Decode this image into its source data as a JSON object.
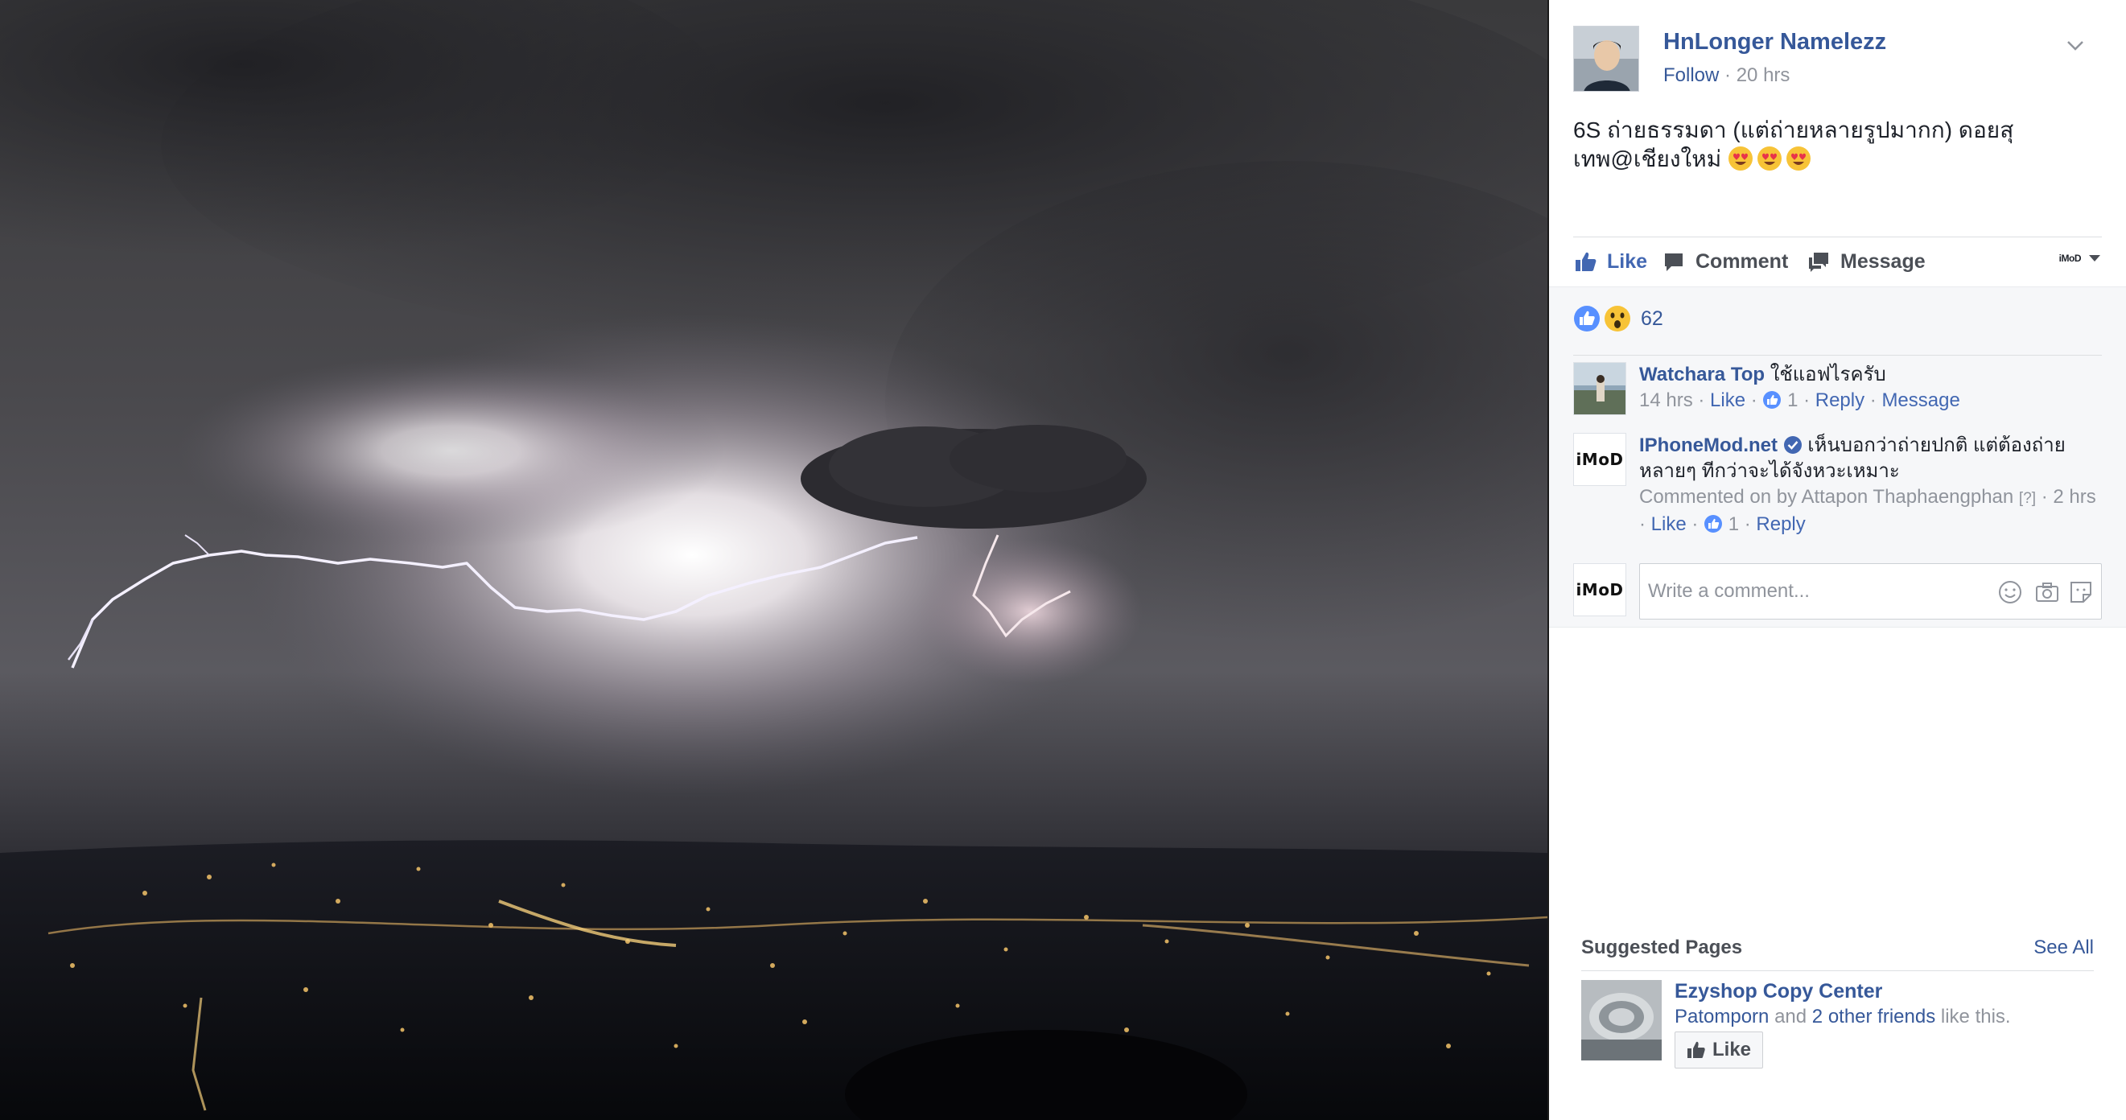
{
  "post": {
    "author": "HnLonger Namelezz",
    "follow_label": "Follow",
    "separator": "·",
    "time": "20 hrs",
    "text": "6S ถ่ายธรรมดา (แต่ถ่ายหลายรูปมากก) ดอยสุเทพ@เชียงใหม่"
  },
  "actions": {
    "like": "Like",
    "comment": "Comment",
    "message": "Message",
    "page_selector": "iMoD"
  },
  "reactions": {
    "count": "62",
    "types": [
      "like-icon",
      "wow-icon"
    ]
  },
  "comments": [
    {
      "author": "Watchara Top",
      "text": "ใช้แอฟไรครับ",
      "time": "14 hrs",
      "like": "Like",
      "likes": "1",
      "reply": "Reply",
      "message": "Message"
    },
    {
      "author": "IPhoneMod.net",
      "verified": true,
      "text": "เห็นบอกว่าถ่ายปกติ แต่ต้องถ่ายหลายๆ ทีกว่าจะได้จังหวะเหมาะ",
      "commented_on_by": "Commented on by Attapon Thaphaengphan",
      "help_marker": "[?]",
      "time": "2 hrs",
      "like": "Like",
      "likes": "1",
      "reply": "Reply"
    }
  ],
  "write_comment": {
    "placeholder": "Write a comment...",
    "avatar_brand": "iMoD"
  },
  "suggested": {
    "title": "Suggested Pages",
    "see_all": "See All",
    "page_name": "Ezyshop Copy Center",
    "friend_name": "Patomporn",
    "and_text": "and",
    "others": "2 other friends",
    "like_this": "like this.",
    "like_button": "Like"
  },
  "colors": {
    "link_blue": "#365899",
    "like_blue": "#4267b2",
    "muted_grey": "#90949c",
    "panel_bg": "#f6f7f9"
  }
}
